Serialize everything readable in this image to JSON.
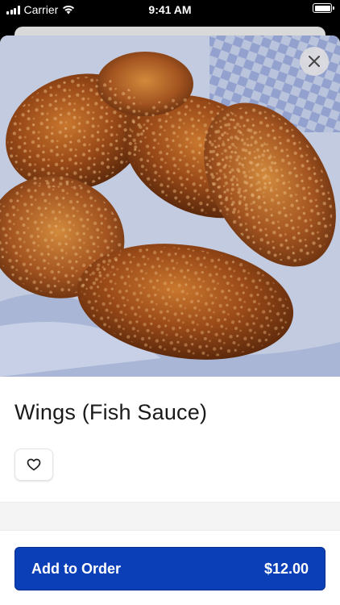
{
  "status_bar": {
    "carrier": "Carrier",
    "time": "9:41 AM"
  },
  "item": {
    "name": "Wings (Fish Sauce)"
  },
  "order_button": {
    "label": "Add to Order",
    "price": "$12.00"
  },
  "icons": {
    "close": "close-icon",
    "favorite": "heart-icon",
    "wifi": "wifi-icon",
    "signal": "signal-icon",
    "battery": "battery-icon"
  },
  "colors": {
    "primary": "#0b3fb8",
    "text": "#1a1a1a",
    "band": "#f4f4f5"
  }
}
